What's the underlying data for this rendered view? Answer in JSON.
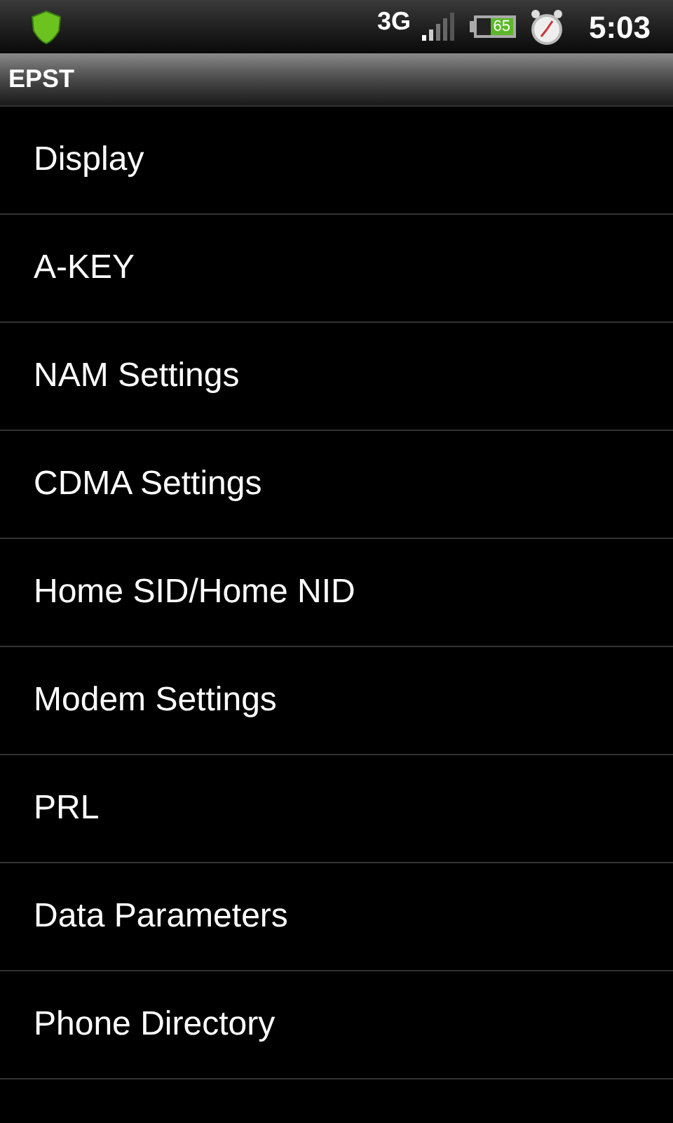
{
  "status_bar": {
    "network": "3G",
    "battery": "65",
    "time": "5:03"
  },
  "title": "EPST",
  "items": [
    {
      "label": "Display"
    },
    {
      "label": "A-KEY"
    },
    {
      "label": "NAM Settings"
    },
    {
      "label": "CDMA Settings"
    },
    {
      "label": "Home SID/Home NID"
    },
    {
      "label": "Modem Settings"
    },
    {
      "label": "PRL"
    },
    {
      "label": "Data Parameters"
    },
    {
      "label": "Phone Directory"
    }
  ]
}
